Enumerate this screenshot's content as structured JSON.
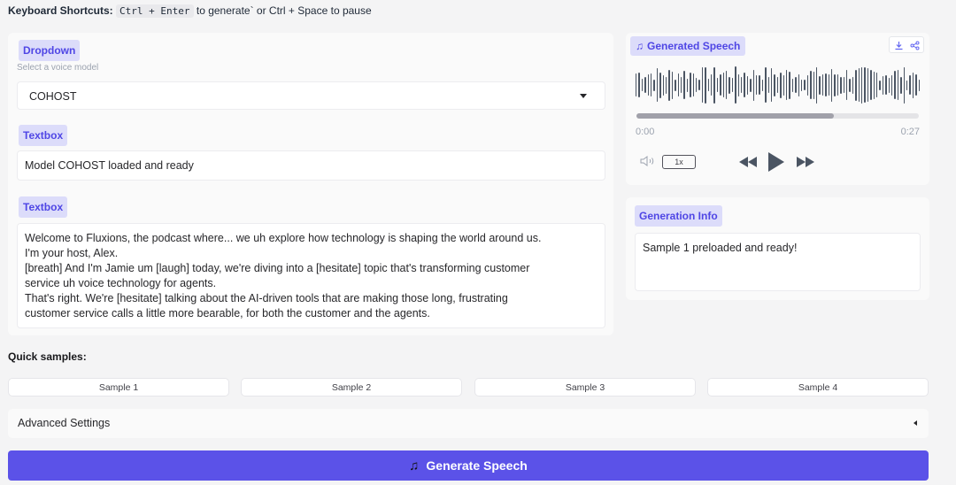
{
  "shortcuts": {
    "prefix": "Keyboard Shortcuts:",
    "combo": "Ctrl + Enter",
    "middle": "to generate` or Ctrl + Space to pause"
  },
  "dropdown": {
    "label": "Dropdown",
    "info": "Select a voice model",
    "selected": "COHOST"
  },
  "status_box": {
    "label": "Textbox",
    "value": "Model COHOST loaded and ready"
  },
  "script_box": {
    "label": "Textbox",
    "lines": [
      "Welcome to Fluxions, the podcast where... we uh explore how technology is shaping the world around us.",
      "I'm your host, Alex.",
      "[breath] And I'm Jamie um [laugh] today, we're diving into a [hesitate] topic that's transforming customer",
      "service uh voice technology for agents.",
      "That's right. We're [hesitate] talking about the AI-driven tools that are making those long, frustrating",
      "customer service calls a little more bearable, for both the customer and the agents."
    ]
  },
  "audio": {
    "label": "Generated Speech",
    "label_icon": "music-note-icon",
    "time_current": "0:00",
    "time_total": "0:27",
    "progress": 0.7,
    "speed": "1x",
    "icons": [
      "download-icon",
      "share-icon",
      "volume-icon",
      "rewind-icon",
      "play-icon",
      "fast-forward-icon"
    ]
  },
  "generation_info": {
    "label": "Generation Info",
    "value": "Sample 1 preloaded and ready!"
  },
  "quick_samples": {
    "heading": "Quick samples:",
    "items": [
      "Sample 1",
      "Sample 2",
      "Sample 3",
      "Sample 4"
    ]
  },
  "advanced": {
    "label": "Advanced Settings"
  },
  "generate": {
    "label": "Generate Speech",
    "icon": "music-note-icon"
  },
  "colors": {
    "accent": "#5b52e8",
    "chip_bg": "#dcdcfa",
    "chip_text": "#4f46e5"
  }
}
